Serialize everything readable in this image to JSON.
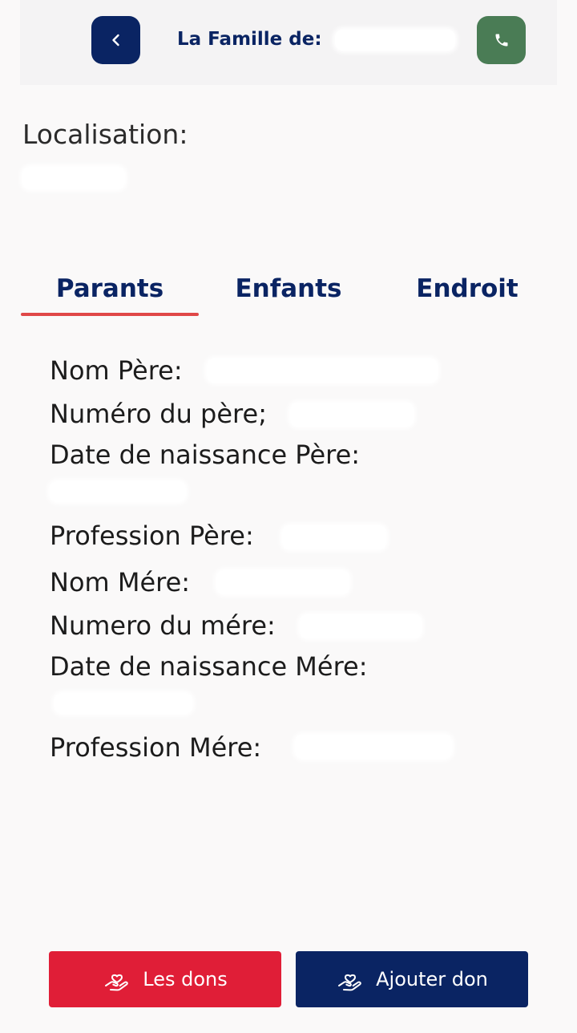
{
  "header": {
    "title": "La Famille de:",
    "back_icon": "chevron-left-icon",
    "call_icon": "phone-icon",
    "colors": {
      "back": "#0a2463",
      "call": "#4a7c55"
    }
  },
  "location": {
    "label": "Localisation:"
  },
  "tabs": [
    {
      "label": "Parants",
      "active": true
    },
    {
      "label": "Enfants",
      "active": false
    },
    {
      "label": "Endroit",
      "active": false
    }
  ],
  "parents": {
    "father_name_label": "Nom Père:",
    "father_phone_label": "Numéro du père;",
    "father_birth_label": "Date de naissance Père:",
    "father_job_label": "Profession Père:",
    "mother_name_label": "Nom Mére:",
    "mother_phone_label": "Numero du mére:",
    "mother_birth_label": "Date de naissance Mére:",
    "mother_job_label": "Profession Mére:"
  },
  "actions": {
    "dons_label": "Les dons",
    "add_label": "Ajouter don",
    "icon": "donation-heart-hand-icon",
    "colors": {
      "dons": "#e01e37",
      "add": "#0a2463"
    }
  }
}
